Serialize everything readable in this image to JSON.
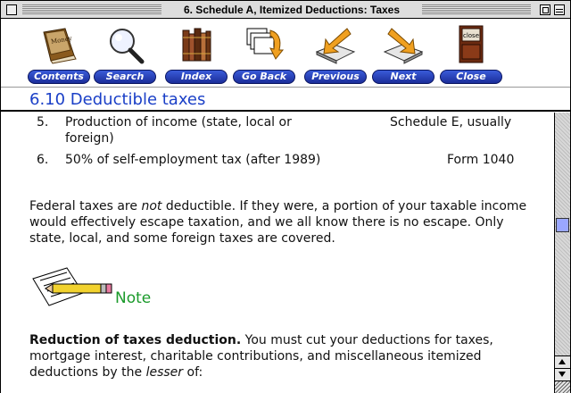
{
  "window": {
    "title": "6. Schedule A, Itemized Deductions: Taxes"
  },
  "toolbar": {
    "buttons": [
      {
        "label": "Contents",
        "icon": "money-book-icon"
      },
      {
        "label": "Search",
        "icon": "magnifier-icon"
      },
      {
        "label": "Index",
        "icon": "books-icon"
      },
      {
        "label": "Go Back",
        "icon": "stacked-pages-back-icon"
      },
      {
        "label": "Previous",
        "icon": "book-arrow-left-icon"
      },
      {
        "label": "Next",
        "icon": "book-arrow-right-icon"
      },
      {
        "label": "Close",
        "icon": "close-book-icon",
        "icon_text": "close"
      }
    ]
  },
  "section": {
    "title": "6.10 Deductible taxes"
  },
  "content": {
    "list": [
      {
        "num": "5.",
        "text_line1": "Production of income (state, local or",
        "text_line2": "foreign)",
        "form": "Schedule E, usually"
      },
      {
        "num": "6.",
        "text_line1": "50% of self-employment tax (after 1989)",
        "text_line2": "",
        "form": "Form 1040"
      }
    ],
    "para1_a": "Federal taxes are ",
    "para1_em": "not",
    "para1_b": " deductible. If they were, a portion of your taxable income would effectively escape taxation, and we all know there is no escape. Only state, local, and some foreign taxes are covered.",
    "note_label": "Note",
    "para2_bold": "Reduction of taxes deduction.",
    "para2_a": " You must cut your deductions for taxes, mortgage interest, charitable contributions, and miscellaneous itemized deductions by the ",
    "para2_em": "lesser",
    "para2_b": " of:"
  },
  "colors": {
    "section_title": "#1a3fc7",
    "note_label": "#1a9a2a",
    "button_blue": "#1b2d9a",
    "scroll_thumb": "#9aa7ff"
  }
}
